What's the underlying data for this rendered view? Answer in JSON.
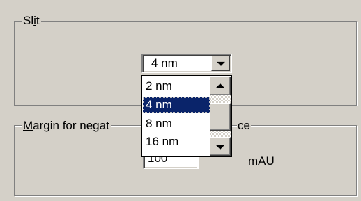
{
  "slit_group": {
    "label_pre": "Sl",
    "label_accel": "i",
    "label_post": "t",
    "selected_value": "4 nm",
    "options": [
      "2 nm",
      "4 nm",
      "8 nm",
      "16 nm"
    ],
    "highlighted_index": 1
  },
  "margin_group": {
    "label_accel": "M",
    "label_visible": "argin for negat",
    "label_tail": "ce",
    "field_value": "100",
    "unit": "mAU"
  },
  "icons": {
    "combo_arrow": "chevron-down-icon",
    "scroll_up": "arrow-up-icon",
    "scroll_down": "arrow-down-icon"
  }
}
